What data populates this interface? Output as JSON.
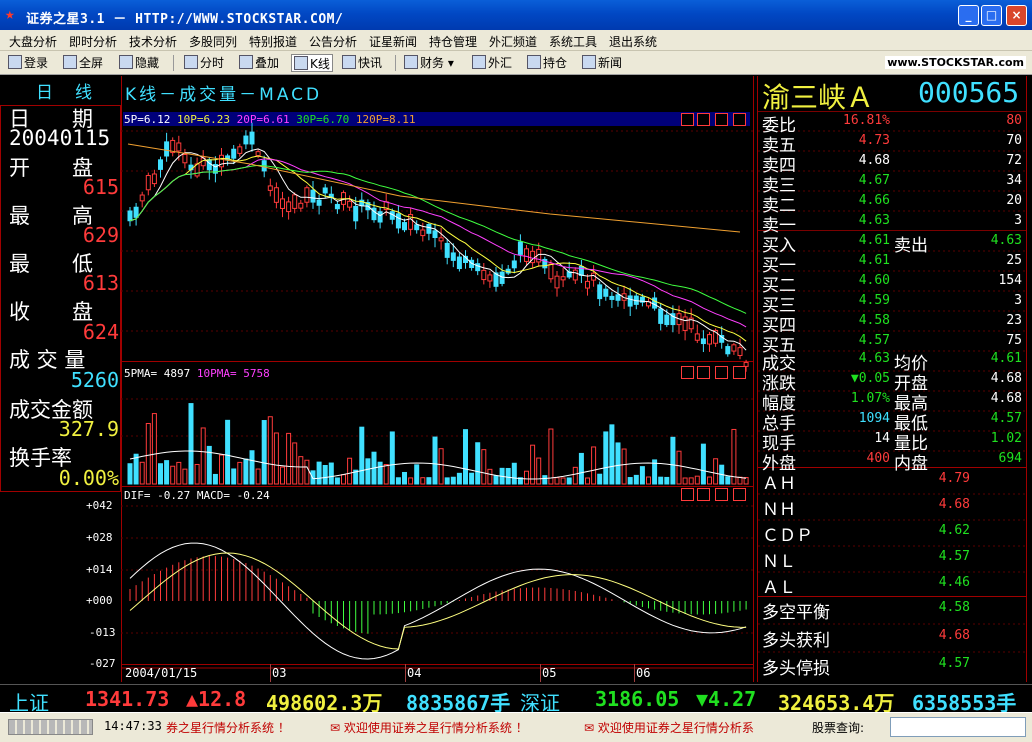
{
  "window": {
    "title": "证券之星3.1 － HTTP://WWW.STOCKSTAR.COM/",
    "btn_min": "_",
    "btn_max": "□",
    "btn_close": "×"
  },
  "menu": [
    "大盘分析",
    "即时分析",
    "技术分析",
    "多股同列",
    "特别报道",
    "公告分析",
    "证星新闻",
    "持仓管理",
    "外汇频道",
    "系统工具",
    "退出系统"
  ],
  "toolbar": {
    "items": [
      "登录",
      "全屏",
      "隐藏",
      "分时",
      "叠加",
      "K线",
      "快讯",
      "财务",
      "外汇",
      "持仓",
      "新闻"
    ],
    "logo": "www.STOCKSTAR.com"
  },
  "left_panel": {
    "tabs": [
      "日",
      "线"
    ],
    "date_label": "日　　期",
    "date": "20040115",
    "open_label": "开　　盘",
    "open": "615",
    "high_label": "最　　高",
    "high": "629",
    "low_label": "最　　低",
    "low": "613",
    "close_label": "收　　盘",
    "close": "624",
    "volume_label": "成 交 量",
    "volume": "5260",
    "amount_label": "成交金额",
    "amount": "327.9",
    "turnover_label": "换手率",
    "turnover": "0.00%"
  },
  "chart": {
    "title": "K线－成交量－MACD",
    "ma_labels": [
      {
        "l": "5P=",
        "v": "6.12"
      },
      {
        "l": "10P=",
        "v": "6.23"
      },
      {
        "l": "20P=",
        "v": "6.61"
      },
      {
        "l": "30P=",
        "v": "6.70"
      },
      {
        "l": "120P=",
        "v": "8.11"
      }
    ],
    "vol_labels": [
      {
        "l": "5PMA=",
        "v": "4897"
      },
      {
        "l": "10PMA=",
        "v": "5758"
      }
    ],
    "macd_labels": {
      "dif_label": "DIF=",
      "dif": "-0.27",
      "macd_label": "MACD=",
      "macd": "-0.24"
    },
    "macd_axis": [
      "+042",
      "+028",
      "+014",
      "+000",
      "-013",
      "-027"
    ],
    "x_axis": [
      "2004/01/15",
      "03",
      "04",
      "05",
      "06"
    ]
  },
  "chart_data": {
    "type": "candlestick",
    "series": [
      {
        "name": "MA5",
        "value": 6.12
      },
      {
        "name": "MA10",
        "value": 6.23
      },
      {
        "name": "MA20",
        "value": 6.61
      },
      {
        "name": "MA30",
        "value": 6.7
      },
      {
        "name": "MA120",
        "value": 8.11
      }
    ],
    "macd_ylim": [
      -0.27,
      0.42
    ],
    "colors": {
      "up": "#ff3b3b",
      "down": "#40e0ff",
      "ma5": "#ffffff",
      "ma10": "#ffff40",
      "ma20": "#ff40ff",
      "ma30": "#40ff40",
      "ma120": "#f0a030"
    }
  },
  "quote": {
    "name": "渝三峡Ａ",
    "code": "000565",
    "wb_label": "委比",
    "wb": "16.81%",
    "wb_diff": "80",
    "sell": [
      {
        "l": "卖五",
        "p": "4.73",
        "v": "70"
      },
      {
        "l": "卖四",
        "p": "4.68",
        "v": "72"
      },
      {
        "l": "卖三",
        "p": "4.67",
        "v": "34"
      },
      {
        "l": "卖二",
        "p": "4.66",
        "v": "20"
      },
      {
        "l": "卖一",
        "p": "4.63",
        "v": "3"
      }
    ],
    "buyin_label": "买入",
    "buyin": "4.61",
    "sellout_label": "卖出",
    "sellout": "4.63",
    "buy": [
      {
        "l": "买一",
        "p": "4.61",
        "v": "25"
      },
      {
        "l": "买二",
        "p": "4.60",
        "v": "154"
      },
      {
        "l": "买三",
        "p": "4.59",
        "v": "3"
      },
      {
        "l": "买四",
        "p": "4.58",
        "v": "23"
      },
      {
        "l": "买五",
        "p": "4.57",
        "v": "75"
      }
    ],
    "deal_label": "成交",
    "deal": "4.63",
    "avg_label": "均价",
    "avg": "4.61",
    "chg_label": "涨跌",
    "chg": "0.05",
    "open_label": "开盘",
    "open": "4.68",
    "pct_label": "幅度",
    "pct": "1.07%",
    "high_label": "最高",
    "high": "4.68",
    "total_label": "总手",
    "total": "1094",
    "low_label": "最低",
    "low": "4.57",
    "cur_label": "现手",
    "cur": "14",
    "lb_label": "量比",
    "lb": "1.02",
    "out_label": "外盘",
    "out": "400",
    "in_label": "内盘",
    "in": "694",
    "indicators": [
      {
        "l": "ＡＨ",
        "v": "4.79"
      },
      {
        "l": "ＮＨ",
        "v": "4.68"
      },
      {
        "l": "ＣＤＰ",
        "v": "4.62"
      },
      {
        "l": "ＮＬ",
        "v": "4.57"
      },
      {
        "l": "ＡＬ",
        "v": "4.46"
      }
    ],
    "signals": [
      {
        "l": "多空平衡",
        "v": "4.58"
      },
      {
        "l": "多头获利",
        "v": "4.68"
      },
      {
        "l": "多头停损",
        "v": "4.57"
      }
    ]
  },
  "ticker": {
    "sh_label": "上证",
    "sh": "1341.73",
    "sh_chg": "▲12.8",
    "sh_amt": "498602.3万",
    "sh_vol": "8835867手",
    "sz_label": "深证",
    "sz": "3186.05",
    "sz_chg": "▼4.27",
    "sz_amt": "324653.4万",
    "sz_vol": "6358553手"
  },
  "status": {
    "time": "14:47:33",
    "msg1": "券之星行情分析系统 ！",
    "msg2": "欢迎使用证券之星行情分析系统 ！",
    "msg3": "欢迎使用证券之星行情分析系",
    "search_label": "股票查询:"
  }
}
